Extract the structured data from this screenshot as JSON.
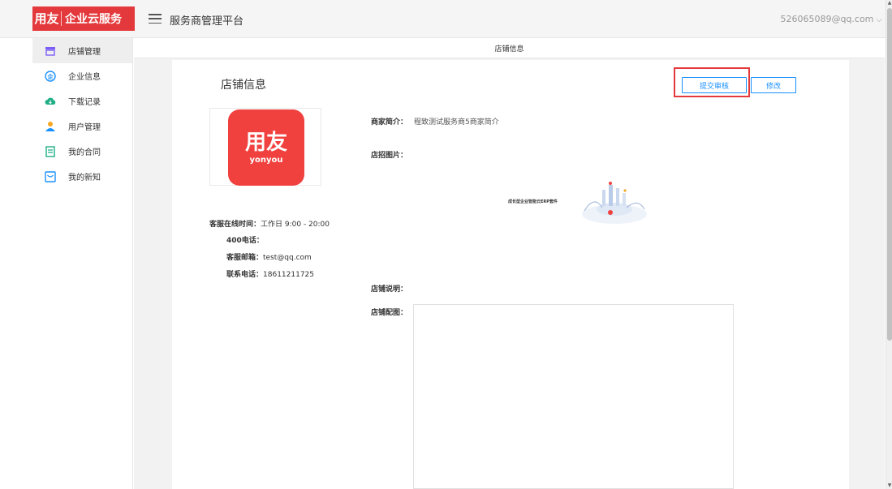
{
  "brand": {
    "logo_text": "用友",
    "name": "企业云服务"
  },
  "header": {
    "platform_title": "服务商管理平台",
    "user_email": "526065089@qq.com",
    "user_chevron": "⌵"
  },
  "sidebar": {
    "items": [
      {
        "label": "店铺管理",
        "icon": "store-icon",
        "active": true
      },
      {
        "label": "企业信息",
        "icon": "enterprise-icon"
      },
      {
        "label": "下载记录",
        "icon": "cloud-download-icon"
      },
      {
        "label": "用户管理",
        "icon": "user-icon"
      },
      {
        "label": "我的合同",
        "icon": "contract-icon"
      },
      {
        "label": "我的新知",
        "icon": "message-icon"
      }
    ]
  },
  "subheader": {
    "title": "店铺信息"
  },
  "panel": {
    "title": "店铺信息",
    "submit_label": "提交审核",
    "edit_label": "修改",
    "logo": {
      "main": "用友",
      "sub": "yonyou"
    },
    "contact": {
      "hours_label": "客服在线时间：",
      "hours_value": "工作日 9:00 - 20:00",
      "phone400_label": "400电话：",
      "phone400_value": "",
      "email_label": "客服邮箱：",
      "email_value": "test@qq.com",
      "tel_label": "联系电话：",
      "tel_value": "18611211725"
    },
    "fields": {
      "intro_label": "商家简介：",
      "intro_value": "程致测试服务商5商家简介",
      "banner_label": "店招图片：",
      "banner_caption": "成长型企业智能云ERP套件",
      "desc_label": "店铺说明：",
      "pics_label": "店铺配图："
    }
  },
  "colors": {
    "brand_red": "#e4393c",
    "logo_red": "#f0413f",
    "primary_blue": "#1890ff",
    "highlight_red": "#e4393c"
  }
}
